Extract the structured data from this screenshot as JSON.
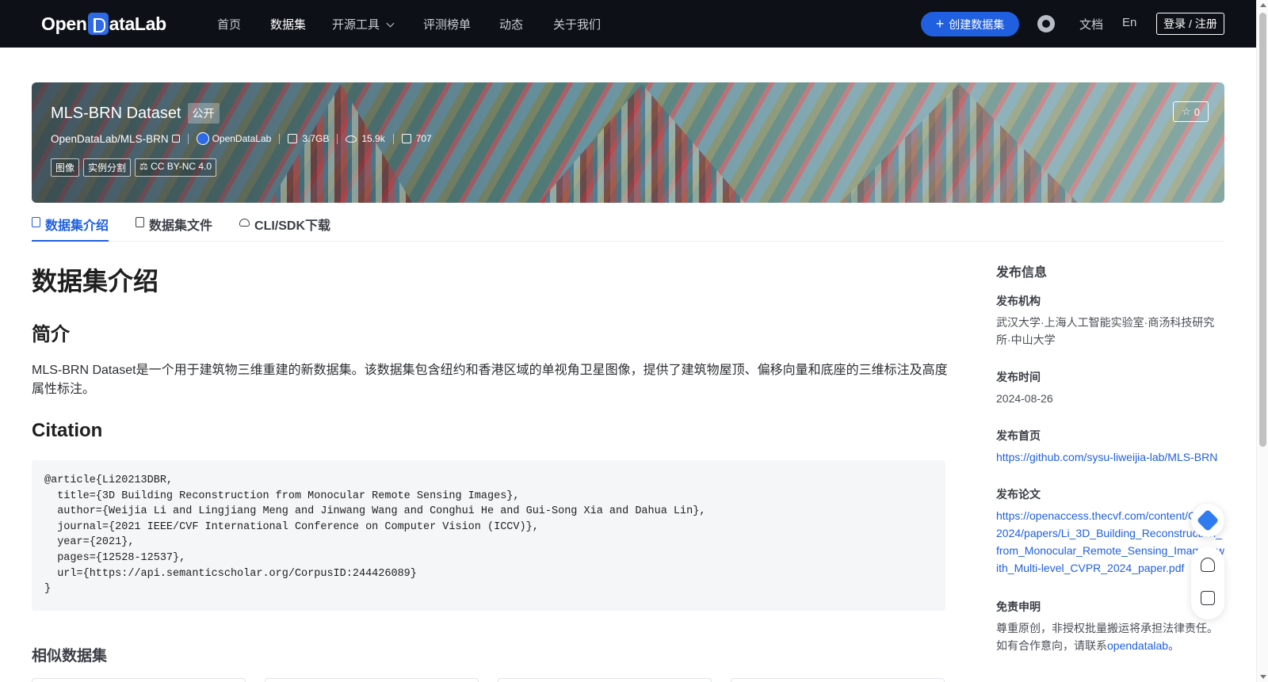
{
  "nav": {
    "logo_pre": "Open",
    "logo_post": "ataLab",
    "items": [
      "首页",
      "数据集",
      "开源工具",
      "评测榜单",
      "动态",
      "关于我们"
    ],
    "create_label": "创建数据集",
    "docs_label": "文档",
    "lang_label": "En",
    "login_label": "登录 / 注册"
  },
  "dataset": {
    "title": "MLS-BRN Dataset",
    "visibility": "公开",
    "path": "OpenDataLab/MLS-BRN",
    "publisher": "OpenDataLab",
    "size": "3.7GB",
    "views": "15.9k",
    "downloads": "707",
    "tags": [
      "图像",
      "实例分割"
    ],
    "license": "CC BY-NC 4.0",
    "stars": "0"
  },
  "tabs": [
    "数据集介绍",
    "数据集文件",
    "CLI/SDK下载"
  ],
  "intro": {
    "heading": "数据集介绍",
    "summary_heading": "简介",
    "summary": "MLS-BRN Dataset是一个用于建筑物三维重建的新数据集。该数据集包含纽约和香港区域的单视角卫星图像，提供了建筑物屋顶、偏移向量和底座的三维标注及高度属性标注。",
    "citation_heading": "Citation",
    "citation": "@article{Li20213DBR,\n  title={3D Building Reconstruction from Monocular Remote Sensing Images},\n  author={Weijia Li and Lingjiang Meng and Jinwang Wang and Conghui He and Gui-Song Xia and Dahua Lin},\n  journal={2021 IEEE/CVF International Conference on Computer Vision (ICCV)},\n  year={2021},\n  pages={12528-12537},\n  url={https://api.semanticscholar.org/CorpusID:244426089}\n}",
    "similar_heading": "相似数据集"
  },
  "sidebar": {
    "title": "发布信息",
    "org_label": "发布机构",
    "org": "武汉大学·上海人工智能实验室·商汤科技研究所·中山大学",
    "date_label": "发布时间",
    "date": "2024-08-26",
    "homepage_label": "发布首页",
    "homepage": "https://github.com/sysu-liweijia-lab/MLS-BRN",
    "paper_label": "发布论文",
    "paper": "https://openaccess.thecvf.com/content/CVPR2024/papers/Li_3D_Building_Reconstruction_from_Monocular_Remote_Sensing_Images_with_Multi-level_CVPR_2024_paper.pdf",
    "disclaimer_label": "免责申明",
    "disclaimer_text": "尊重原创，非授权批量搬运将承担法律责任。如有合作意向，请联系",
    "disclaimer_link": "opendatalab",
    "disclaimer_end": "。"
  },
  "colors": {
    "nav_bg": "#0d1117",
    "accent": "#1f5fe0",
    "link": "#1f5fe0"
  }
}
